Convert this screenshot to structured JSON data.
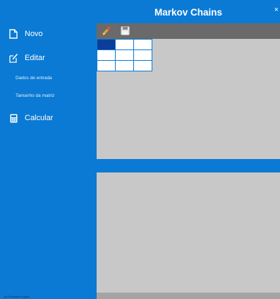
{
  "app": {
    "title": "Markov Chains",
    "close_label": "×"
  },
  "sidebar": {
    "items": [
      {
        "label": "Novo",
        "icon": "file-icon"
      },
      {
        "label": "Editar",
        "icon": "edit-icon"
      },
      {
        "label": "Calcular",
        "icon": "calculator-icon"
      }
    ],
    "sub_items": [
      {
        "label": "Dados de entrada"
      },
      {
        "label": "Tamanho da matriz"
      }
    ],
    "footer_note": "by Clodomiro Lopes"
  },
  "toolbar": {
    "tools": [
      {
        "name": "pencil-icon",
        "state": "enabled"
      },
      {
        "name": "save-icon",
        "state": "disabled"
      }
    ]
  },
  "matrix": {
    "rows": 3,
    "cols": 3,
    "cells": [
      [
        "",
        "",
        ""
      ],
      [
        "",
        "",
        ""
      ],
      [
        "",
        "",
        ""
      ]
    ],
    "selected": [
      0,
      0
    ]
  },
  "colors": {
    "accent": "#0a7ad4",
    "panel": "#c8c8c8",
    "toolbar": "#6a6a6a",
    "selected_cell": "#0b3e9a"
  }
}
